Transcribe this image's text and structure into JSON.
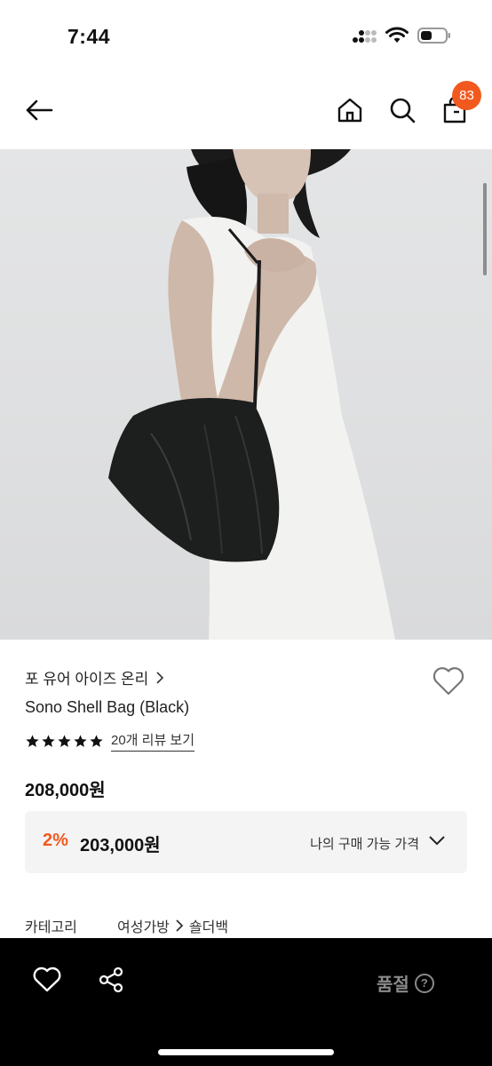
{
  "status_bar": {
    "time": "7:44"
  },
  "header": {
    "cart_count": "83"
  },
  "product": {
    "brand": "포 유어 아이즈 온리",
    "name": "Sono Shell Bag (Black)",
    "rating": 5,
    "review_link": "20개 리뷰 보기",
    "price": "208,000원",
    "discount": {
      "rate": "2%",
      "price": "203,000원",
      "label": "나의 구매 가능 가격"
    },
    "category": {
      "label": "카테고리",
      "path": [
        "여성가방",
        "숄더백"
      ]
    }
  },
  "bottom_bar": {
    "status": "품절"
  },
  "colors": {
    "accent": "#f2591e",
    "bar": "#000000"
  }
}
